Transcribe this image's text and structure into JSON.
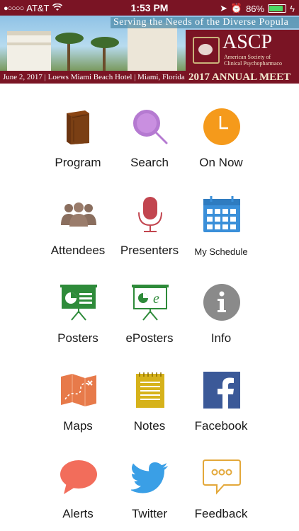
{
  "status_bar": {
    "carrier": "AT&T",
    "time": "1:53 PM",
    "battery": "86%",
    "battery_fraction": 0.86
  },
  "banner": {
    "tagline": "Serving the Needs of the Diverse Popula",
    "org_short": "ASCP",
    "org_long_1": "American Society of",
    "org_long_2": "Clinical Psychopharmaco",
    "dates": "June 2, 2017 | Loews Miami Beach Hotel | Miami, Florida",
    "meeting": "2017 ANNUAL MEET",
    "colors": {
      "maroon": "#7a1424",
      "gold": "#c9b27a"
    }
  },
  "menu": [
    {
      "label": "Program",
      "icon": "book-icon"
    },
    {
      "label": "Search",
      "icon": "magnifier-icon"
    },
    {
      "label": "On Now",
      "icon": "clock-icon"
    },
    {
      "label": "Attendees",
      "icon": "people-icon"
    },
    {
      "label": "Presenters",
      "icon": "microphone-icon"
    },
    {
      "label": "My Schedule",
      "icon": "calendar-icon"
    },
    {
      "label": "Posters",
      "icon": "poster-board-icon"
    },
    {
      "label": "ePosters",
      "icon": "eposter-board-icon"
    },
    {
      "label": "Info",
      "icon": "info-icon"
    },
    {
      "label": "Maps",
      "icon": "map-icon"
    },
    {
      "label": "Notes",
      "icon": "notepad-icon"
    },
    {
      "label": "Facebook",
      "icon": "facebook-icon"
    },
    {
      "label": "Alerts",
      "icon": "speech-bubble-icon"
    },
    {
      "label": "Twitter",
      "icon": "twitter-bird-icon"
    },
    {
      "label": "Feedback",
      "icon": "chat-dots-icon"
    }
  ]
}
